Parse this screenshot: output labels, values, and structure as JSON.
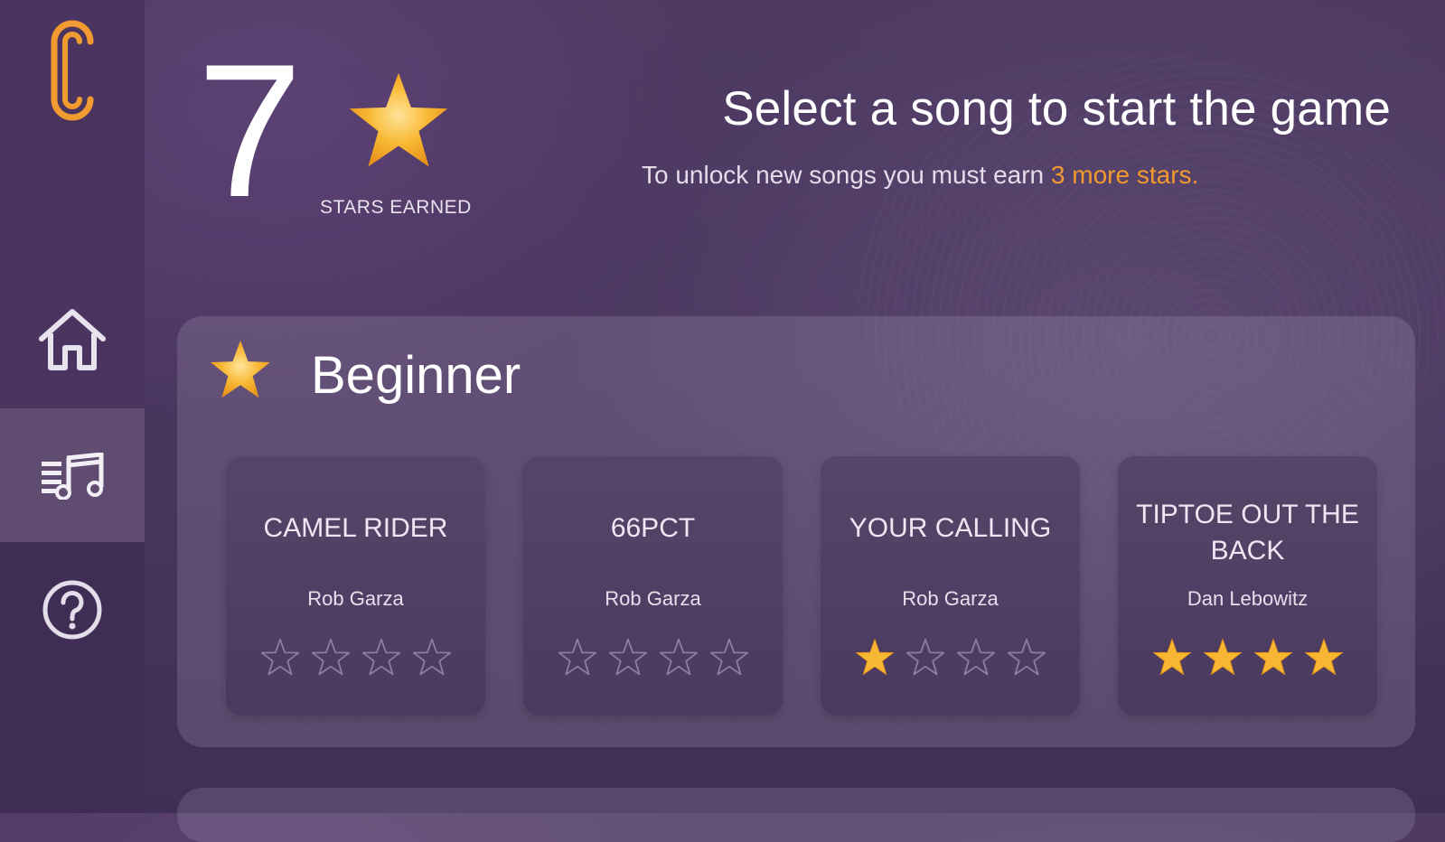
{
  "header": {
    "stars_count": "7",
    "stars_label": "STARS EARNED",
    "title": "Select a song to start the game",
    "subtitle_prefix": "To unlock new songs you must earn ",
    "subtitle_highlight": "3 more stars."
  },
  "sidebar": {
    "items": [
      {
        "name": "home",
        "icon": "home-icon"
      },
      {
        "name": "songs",
        "icon": "music-list-icon",
        "active": true
      },
      {
        "name": "help",
        "icon": "help-icon"
      }
    ]
  },
  "sections": [
    {
      "title": "Beginner",
      "songs": [
        {
          "title": "CAMEL RIDER",
          "artist": "Rob Garza",
          "stars": 0,
          "max_stars": 4
        },
        {
          "title": "66PCT",
          "artist": "Rob Garza",
          "stars": 0,
          "max_stars": 4
        },
        {
          "title": "YOUR CALLING",
          "artist": "Rob Garza",
          "stars": 1,
          "max_stars": 4
        },
        {
          "title": "TIPTOE OUT THE BACK",
          "artist": "Dan Lebowitz",
          "stars": 4,
          "max_stars": 4
        }
      ]
    }
  ],
  "colors": {
    "accent": "#f29a2e",
    "star_fill": "#f7b733",
    "background": "#4a3760"
  }
}
